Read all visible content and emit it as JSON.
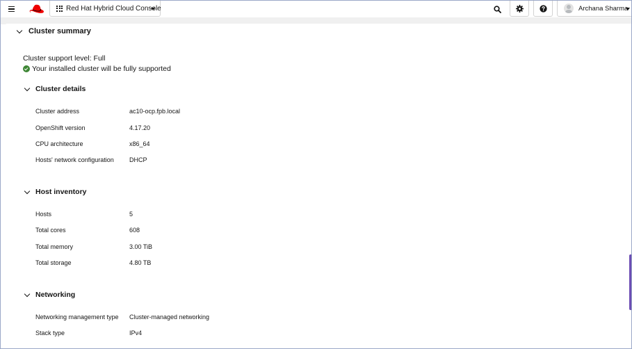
{
  "masthead": {
    "app_title": "Red Hat Hybrid Cloud Console",
    "user_name": "Archana Sharma",
    "icons": {
      "menu": "hamburger-icon",
      "logo": "redhat-logo",
      "apps": "grid-icon",
      "search": "search-icon",
      "settings": "gear-icon",
      "help": "question-circle-icon",
      "user": "avatar"
    }
  },
  "summary": {
    "title": "Cluster summary",
    "support_level": "Cluster support level: Full",
    "support_status": "Your installed cluster will be fully supported"
  },
  "cluster_details": {
    "title": "Cluster details",
    "rows": [
      {
        "label": "Cluster address",
        "value": "ac10-ocp.fpb.local"
      },
      {
        "label": "OpenShift version",
        "value": "4.17.20"
      },
      {
        "label": "CPU architecture",
        "value": "x86_64"
      },
      {
        "label": "Hosts' network configuration",
        "value": "DHCP"
      }
    ]
  },
  "host_inventory": {
    "title": "Host inventory",
    "rows": [
      {
        "label": "Hosts",
        "value": "5"
      },
      {
        "label": "Total cores",
        "value": "608"
      },
      {
        "label": "Total memory",
        "value": "3.00 TiB"
      },
      {
        "label": "Total storage",
        "value": "4.80 TB"
      }
    ]
  },
  "networking": {
    "title": "Networking",
    "rows": [
      {
        "label": "Networking management type",
        "value": "Cluster-managed networking"
      },
      {
        "label": "Stack type",
        "value": "IPv4"
      }
    ]
  },
  "colors": {
    "brand_red": "#ee0000",
    "success_green": "#3e8635",
    "accent_purple": "#6c4db4"
  }
}
